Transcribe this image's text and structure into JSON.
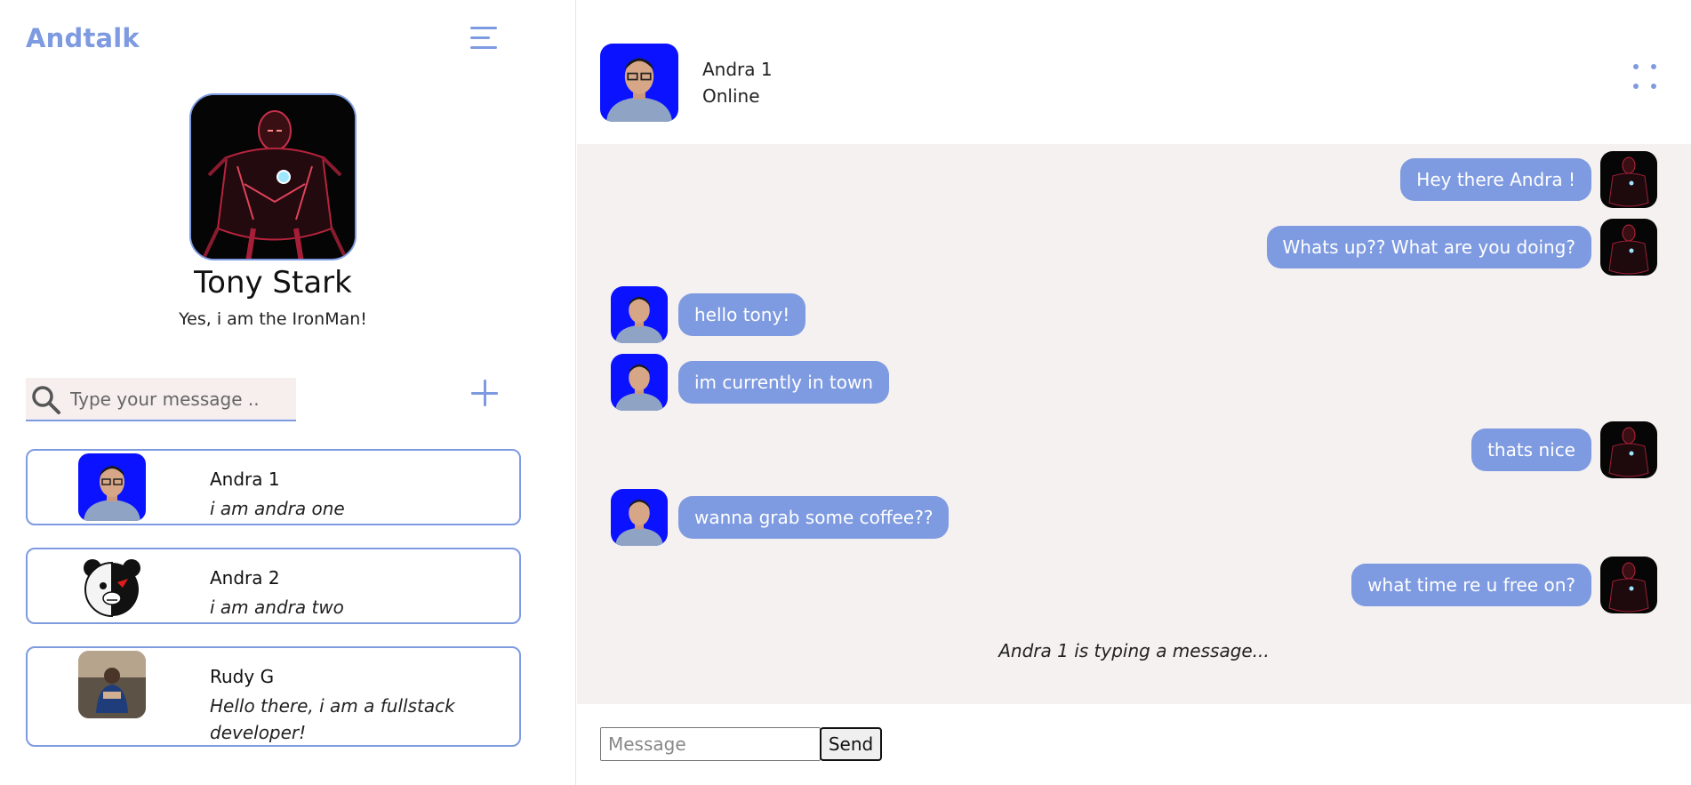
{
  "app": {
    "brand": "Andtalk"
  },
  "colors": {
    "accent": "#7e9ae0",
    "chat_bg": "#f5f1f0",
    "search_bg": "#f6efee"
  },
  "profile": {
    "name": "Tony Stark",
    "status": "Yes, i am the IronMan!",
    "avatar_icon": "ironman-avatar"
  },
  "search": {
    "placeholder": "Type your message .."
  },
  "contacts": [
    {
      "name": "Andra 1",
      "message": "i am andra one",
      "avatar_icon": "blue-portrait-avatar"
    },
    {
      "name": "Andra 2",
      "message": "i am andra two",
      "avatar_icon": "bear-avatar"
    },
    {
      "name": "Rudy G",
      "message": "Hello there, i am a fullstack developer!",
      "avatar_icon": "photo-avatar"
    }
  ],
  "chat": {
    "header": {
      "name": "Andra 1",
      "status": "Online"
    },
    "messages": [
      {
        "side": "right",
        "text": "Hey there Andra !"
      },
      {
        "side": "right",
        "text": "Whats up?? What are you doing?"
      },
      {
        "side": "left",
        "text": "hello tony!"
      },
      {
        "side": "left",
        "text": "im currently in town"
      },
      {
        "side": "right",
        "text": "thats nice"
      },
      {
        "side": "left",
        "text": "wanna grab some coffee??"
      },
      {
        "side": "right",
        "text": "what time re u free on?"
      }
    ],
    "typing": "Andra 1 is typing a message..."
  },
  "composer": {
    "placeholder": "Message",
    "send_label": "Send"
  }
}
